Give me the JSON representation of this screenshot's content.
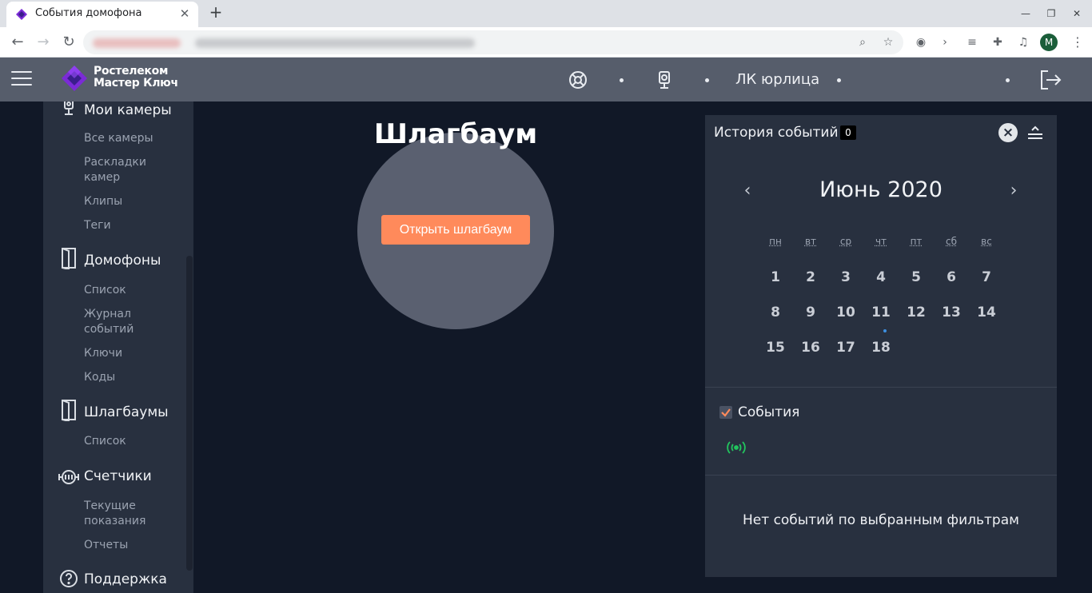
{
  "browser": {
    "tab_title": "События домофона",
    "tab_close": "✕",
    "new_tab": "+",
    "profile_initial": "M"
  },
  "header": {
    "logo_line1": "Ростелеком",
    "logo_line2": "Мастер Ключ",
    "account_label": "ЛК юрлица"
  },
  "sidebar": {
    "sections": [
      {
        "label": "Мои камеры",
        "icon": "camera-icon",
        "items": [
          "Все камеры",
          "Раскладки камер",
          "Клипы",
          "Теги"
        ]
      },
      {
        "label": "Домофоны",
        "icon": "door-icon",
        "items": [
          "Список",
          "Журнал событий",
          "Ключи",
          "Коды"
        ]
      },
      {
        "label": "Шлагбаумы",
        "icon": "door-icon",
        "items": [
          "Список"
        ]
      },
      {
        "label": "Счетчики",
        "icon": "meter-icon",
        "items": [
          "Текущие показания",
          "Отчеты"
        ]
      },
      {
        "label": "Поддержка",
        "icon": "help-icon",
        "items": []
      }
    ]
  },
  "main": {
    "title": "Шлагбаум",
    "open_button": "Открыть шлагбаум"
  },
  "events_panel": {
    "title": "История событий",
    "count": "0",
    "month": "Июнь 2020",
    "weekdays": [
      "пн",
      "вт",
      "ср",
      "чт",
      "пт",
      "сб",
      "вс"
    ],
    "days": [
      "1",
      "2",
      "3",
      "4",
      "5",
      "6",
      "7",
      "8",
      "9",
      "10",
      "11",
      "12",
      "13",
      "14",
      "15",
      "16",
      "17",
      "18"
    ],
    "marked_day": "11",
    "filter_label": "События",
    "filter_checked": true,
    "empty_message": "Нет событий по выбранным фильтрам"
  },
  "colors": {
    "accent": "#ff8a5b",
    "header_bg": "#565d6b",
    "page_bg": "#111827",
    "panel_bg": "#28303f",
    "event_icon": "#22c55e",
    "day_marker": "#3d8fe0"
  }
}
